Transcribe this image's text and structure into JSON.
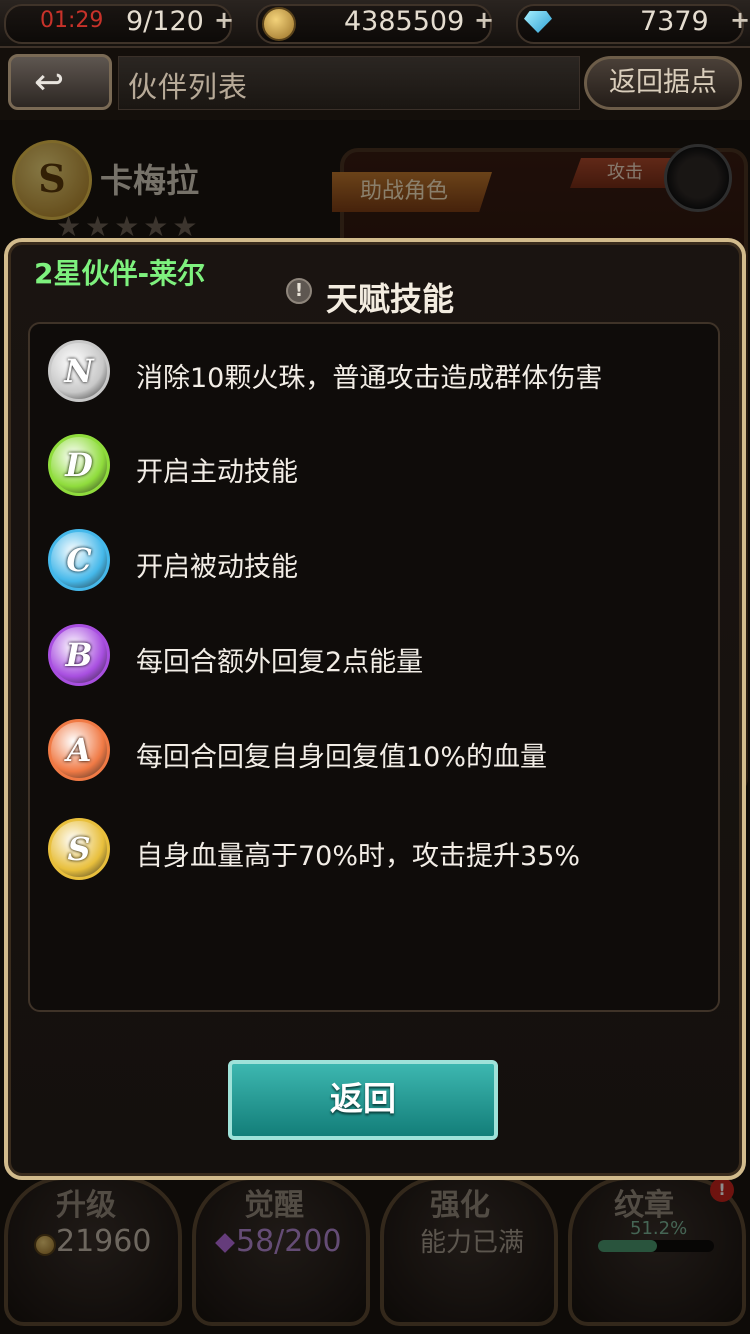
{
  "status": {
    "time": "01:29",
    "stamina": "9/120",
    "gold": "4385509",
    "gems": "7379",
    "plus_icon": "+"
  },
  "header": {
    "back_icon": "back-arrow",
    "title": "伙伴列表",
    "return_base": "返回据点"
  },
  "background": {
    "rank": "S",
    "hero_name": "卡梅拉",
    "support_tag": "助战角色",
    "attack_tag": "攻击",
    "stars": "★★★★★"
  },
  "bottom_buttons": [
    {
      "title": "升级",
      "value": "21960"
    },
    {
      "title": "觉醒",
      "value": "58/200"
    },
    {
      "title": "强化",
      "value": "能力已满"
    },
    {
      "title": "纹章",
      "value": "51.2%",
      "progress": 0.512
    }
  ],
  "badge": "!",
  "modal": {
    "partner_label": "2星伙伴-莱尔",
    "title": "天赋技能",
    "title_icon": "!",
    "skills": [
      {
        "grade": "N",
        "text": "消除10颗火珠，普通攻击造成群体伤害",
        "color": "#c8c8c8"
      },
      {
        "grade": "D",
        "text": "开启主动技能",
        "color": "#8fdc3c"
      },
      {
        "grade": "C",
        "text": "开启被动技能",
        "color": "#45b8ea"
      },
      {
        "grade": "B",
        "text": "每回合额外回复2点能量",
        "color": "#a84fe0"
      },
      {
        "grade": "A",
        "text": "每回合回复自身回复值10%的血量",
        "color": "#f07a45"
      },
      {
        "grade": "S",
        "text": "自身血量高于70%时，攻击提升35%",
        "color": "#e8bf3c"
      }
    ],
    "return_button": "返回"
  }
}
